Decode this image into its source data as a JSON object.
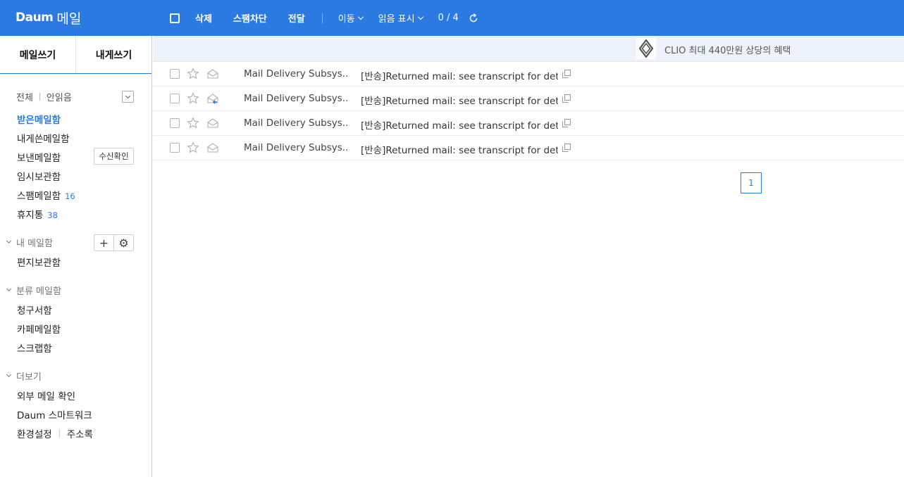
{
  "brand": {
    "logo_text": "Daum",
    "service": "메일"
  },
  "toolbar": {
    "delete": "삭제",
    "spam": "스팸차단",
    "forward": "전달",
    "move": "이동",
    "mark_read": "읽음 표시",
    "count": "0 / 4"
  },
  "compose": {
    "write": "메일쓰기",
    "to_me": "내게쓰기"
  },
  "filter": {
    "all": "전체",
    "unread": "안읽음"
  },
  "mailboxes": {
    "inbox": "받은메일함",
    "to_me": "내게쓴메일함",
    "sent": "보낸메일함",
    "receipt_check": "수신확인",
    "drafts": "임시보관함",
    "spam": "스팸메일함",
    "spam_count": "16",
    "trash": "휴지통",
    "trash_count": "38"
  },
  "my_mailbox": {
    "title": "내 메일함",
    "items": [
      "편지보관함"
    ]
  },
  "category": {
    "title": "분류 메일함",
    "items": [
      "청구서함",
      "카페메일함",
      "스크랩함"
    ]
  },
  "more": {
    "title": "더보기",
    "items": [
      "외부 메일 확인",
      "Daum 스마트워크"
    ],
    "settings": "환경설정",
    "contacts": "주소록"
  },
  "ad": {
    "text": "CLIO 최대 440만원 상당의 혜택"
  },
  "emails": [
    {
      "sender": "Mail Delivery Subsys...",
      "subject": "[반송]Returned mail: see transcript for detai",
      "icon": "envelope-icon"
    },
    {
      "sender": "Mail Delivery Subsys...",
      "subject": "[반송]Returned mail: see transcript for detai",
      "icon": "envelope-reply-icon"
    },
    {
      "sender": "Mail Delivery Subsys...",
      "subject": "[반송]Returned mail: see transcript for detai",
      "icon": "envelope-icon"
    },
    {
      "sender": "Mail Delivery Subsys...",
      "subject": "[반송]Returned mail: see transcript for detai",
      "icon": "envelope-icon"
    }
  ],
  "pagination": {
    "current": "1"
  },
  "colors": {
    "brand_blue": "#2a7ae2",
    "ad_bg": "#eef3fb"
  }
}
